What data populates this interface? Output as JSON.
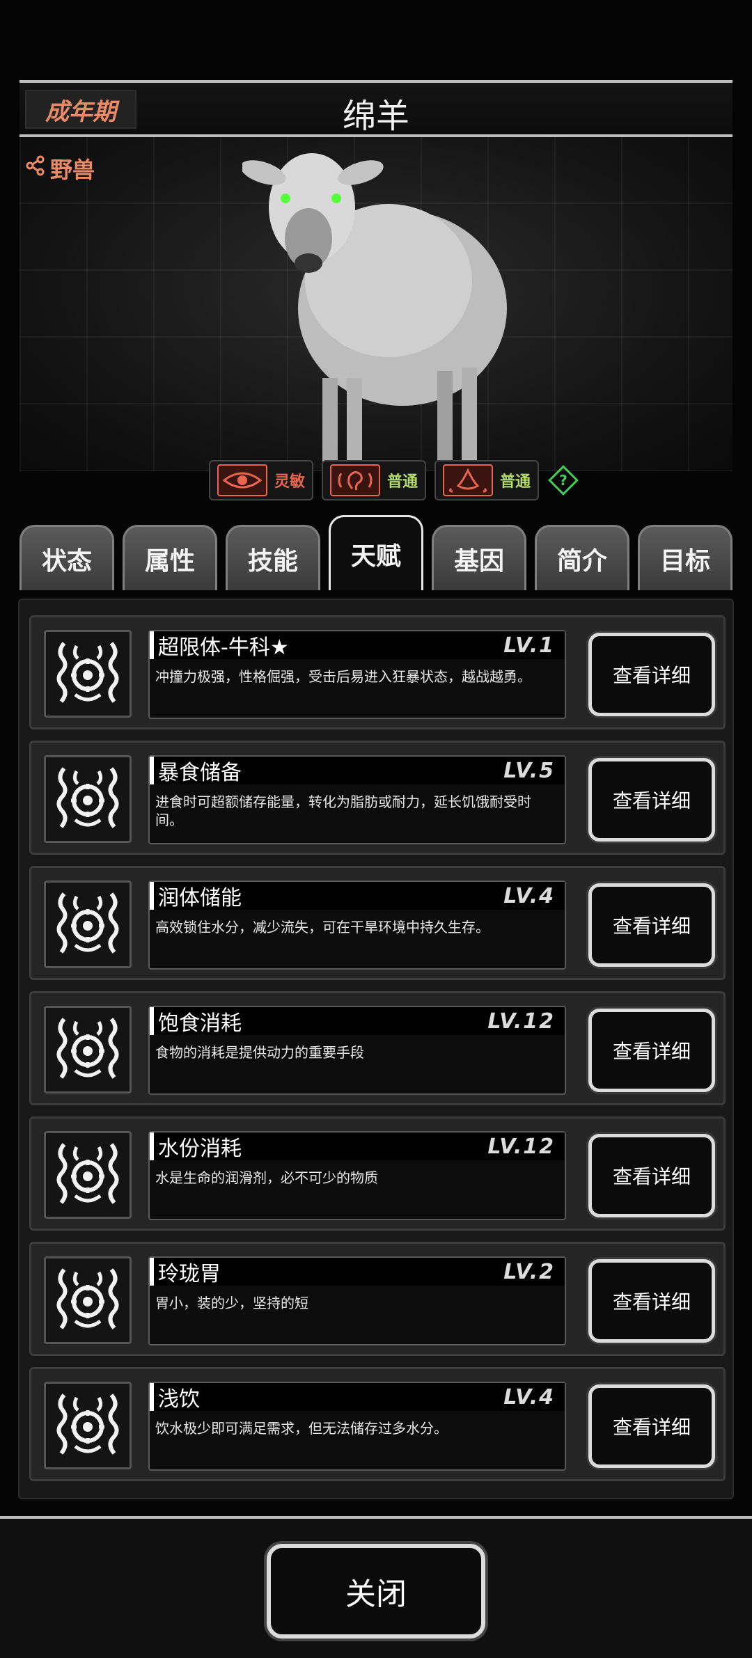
{
  "header": {
    "stage": "成年期",
    "title": "绵羊"
  },
  "portrait": {
    "species_tag": "野兽"
  },
  "traits": [
    {
      "icon": "eye-icon",
      "label": "灵敏",
      "color": "#e8664f"
    },
    {
      "icon": "ear-icon",
      "label": "普通",
      "color": "#b0d86c"
    },
    {
      "icon": "nose-icon",
      "label": "普通",
      "color": "#b0d86c"
    }
  ],
  "help": {
    "icon": "question-icon",
    "color": "#3fcf52"
  },
  "tabs": [
    {
      "label": "状态",
      "active": false
    },
    {
      "label": "属性",
      "active": false
    },
    {
      "label": "技能",
      "active": false
    },
    {
      "label": "天赋",
      "active": true
    },
    {
      "label": "基因",
      "active": false
    },
    {
      "label": "简介",
      "active": false
    },
    {
      "label": "目标",
      "active": false
    }
  ],
  "talents": [
    {
      "name": "超限体-牛科★",
      "level": "LV.1",
      "desc": "冲撞力极强，性格倔强，受击后易进入狂暴状态，越战越勇。",
      "button": "查看详细"
    },
    {
      "name": "暴食储备",
      "level": "LV.5",
      "desc": "进食时可超额储存能量，转化为脂肪或耐力，延长饥饿耐受时间。",
      "button": "查看详细"
    },
    {
      "name": "润体储能",
      "level": "LV.4",
      "desc": "高效锁住水分，减少流失，可在干旱环境中持久生存。",
      "button": "查看详细"
    },
    {
      "name": "饱食消耗",
      "level": "LV.12",
      "desc": "食物的消耗是提供动力的重要手段",
      "button": "查看详细"
    },
    {
      "name": "水份消耗",
      "level": "LV.12",
      "desc": "水是生命的润滑剂，必不可少的物质",
      "button": "查看详细"
    },
    {
      "name": "玲珑胃",
      "level": "LV.2",
      "desc": "胃小，装的少，坚持的短",
      "button": "查看详细"
    },
    {
      "name": "浅饮",
      "level": "LV.4",
      "desc": "饮水极少即可满足需求，但无法储存过多水分。",
      "button": "查看详细"
    }
  ],
  "footer": {
    "close_label": "关闭"
  }
}
